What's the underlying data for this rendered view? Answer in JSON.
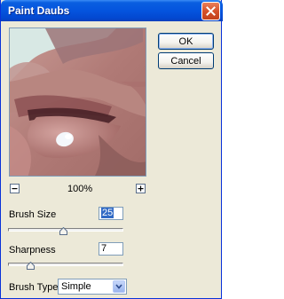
{
  "window": {
    "title": "Paint Daubs"
  },
  "buttons": {
    "ok": "OK",
    "cancel": "Cancel"
  },
  "preview": {
    "zoom": "100%"
  },
  "controls": {
    "brush_size": {
      "label": "Brush Size",
      "value": "25",
      "level": 0.48
    },
    "sharpness": {
      "label": "Sharpness",
      "value": "7",
      "level": 0.17
    },
    "brush_type": {
      "label": "Brush Type:",
      "selected": "Simple"
    }
  },
  "colors": {
    "titlebar": "#0454de",
    "dialog": "#ece9d8",
    "selection": "#316ac5"
  }
}
